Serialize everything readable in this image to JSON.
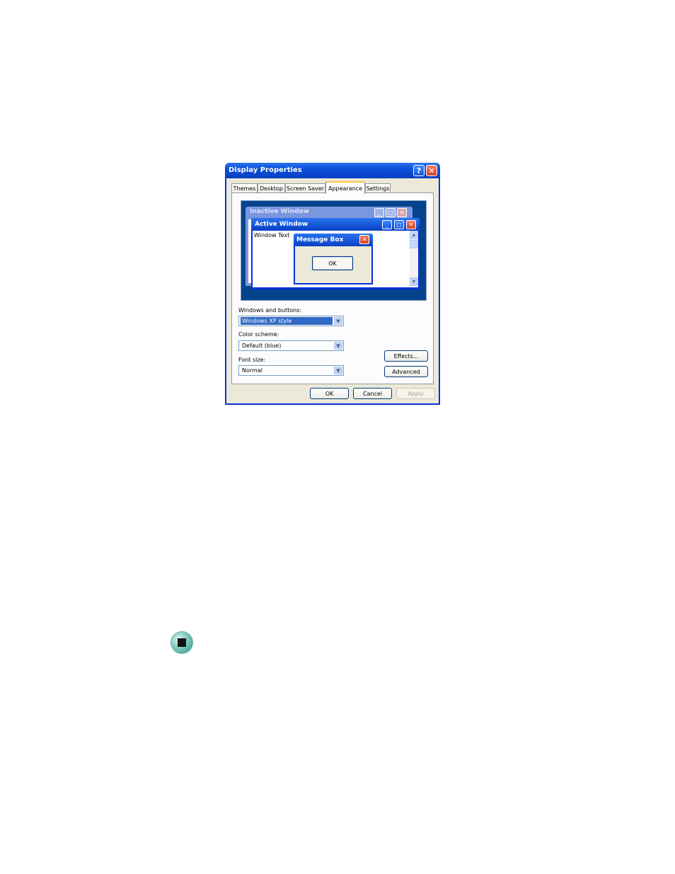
{
  "dialog": {
    "title": "Display Properties",
    "help_glyph": "?",
    "close_glyph": "✕",
    "tabs": [
      {
        "label": "Themes",
        "active": false
      },
      {
        "label": "Desktop",
        "active": false
      },
      {
        "label": "Screen Saver",
        "active": false
      },
      {
        "label": "Appearance",
        "active": true
      },
      {
        "label": "Settings",
        "active": false
      }
    ]
  },
  "preview": {
    "inactive_window_title": "Inactive Window",
    "active_window_title": "Active Window",
    "window_text": "Window Text",
    "message_box_title": "Message Box",
    "message_box_ok": "OK",
    "minimize_glyph": "_",
    "maximize_glyph": "□",
    "close_glyph": "✕",
    "scroll_up_glyph": "▲",
    "scroll_down_glyph": "▼"
  },
  "form": {
    "windows_buttons_label": "Windows and buttons:",
    "windows_buttons_value": "Windows XP style",
    "color_scheme_label": "Color scheme:",
    "color_scheme_value": "Default (blue)",
    "font_size_label": "Font size:",
    "font_size_value": "Normal",
    "dropdown_glyph": "▼",
    "effects_label": "Effects...",
    "advanced_label": "Advanced"
  },
  "footer": {
    "ok_label": "OK",
    "cancel_label": "Cancel",
    "apply_label": "Apply"
  },
  "colors": {
    "xp_blue": "#0831d9",
    "dialog_face": "#ece9d8",
    "preview_desktop": "#06438e",
    "selection": "#316ac5",
    "tab_highlight": "#ffc83c"
  }
}
